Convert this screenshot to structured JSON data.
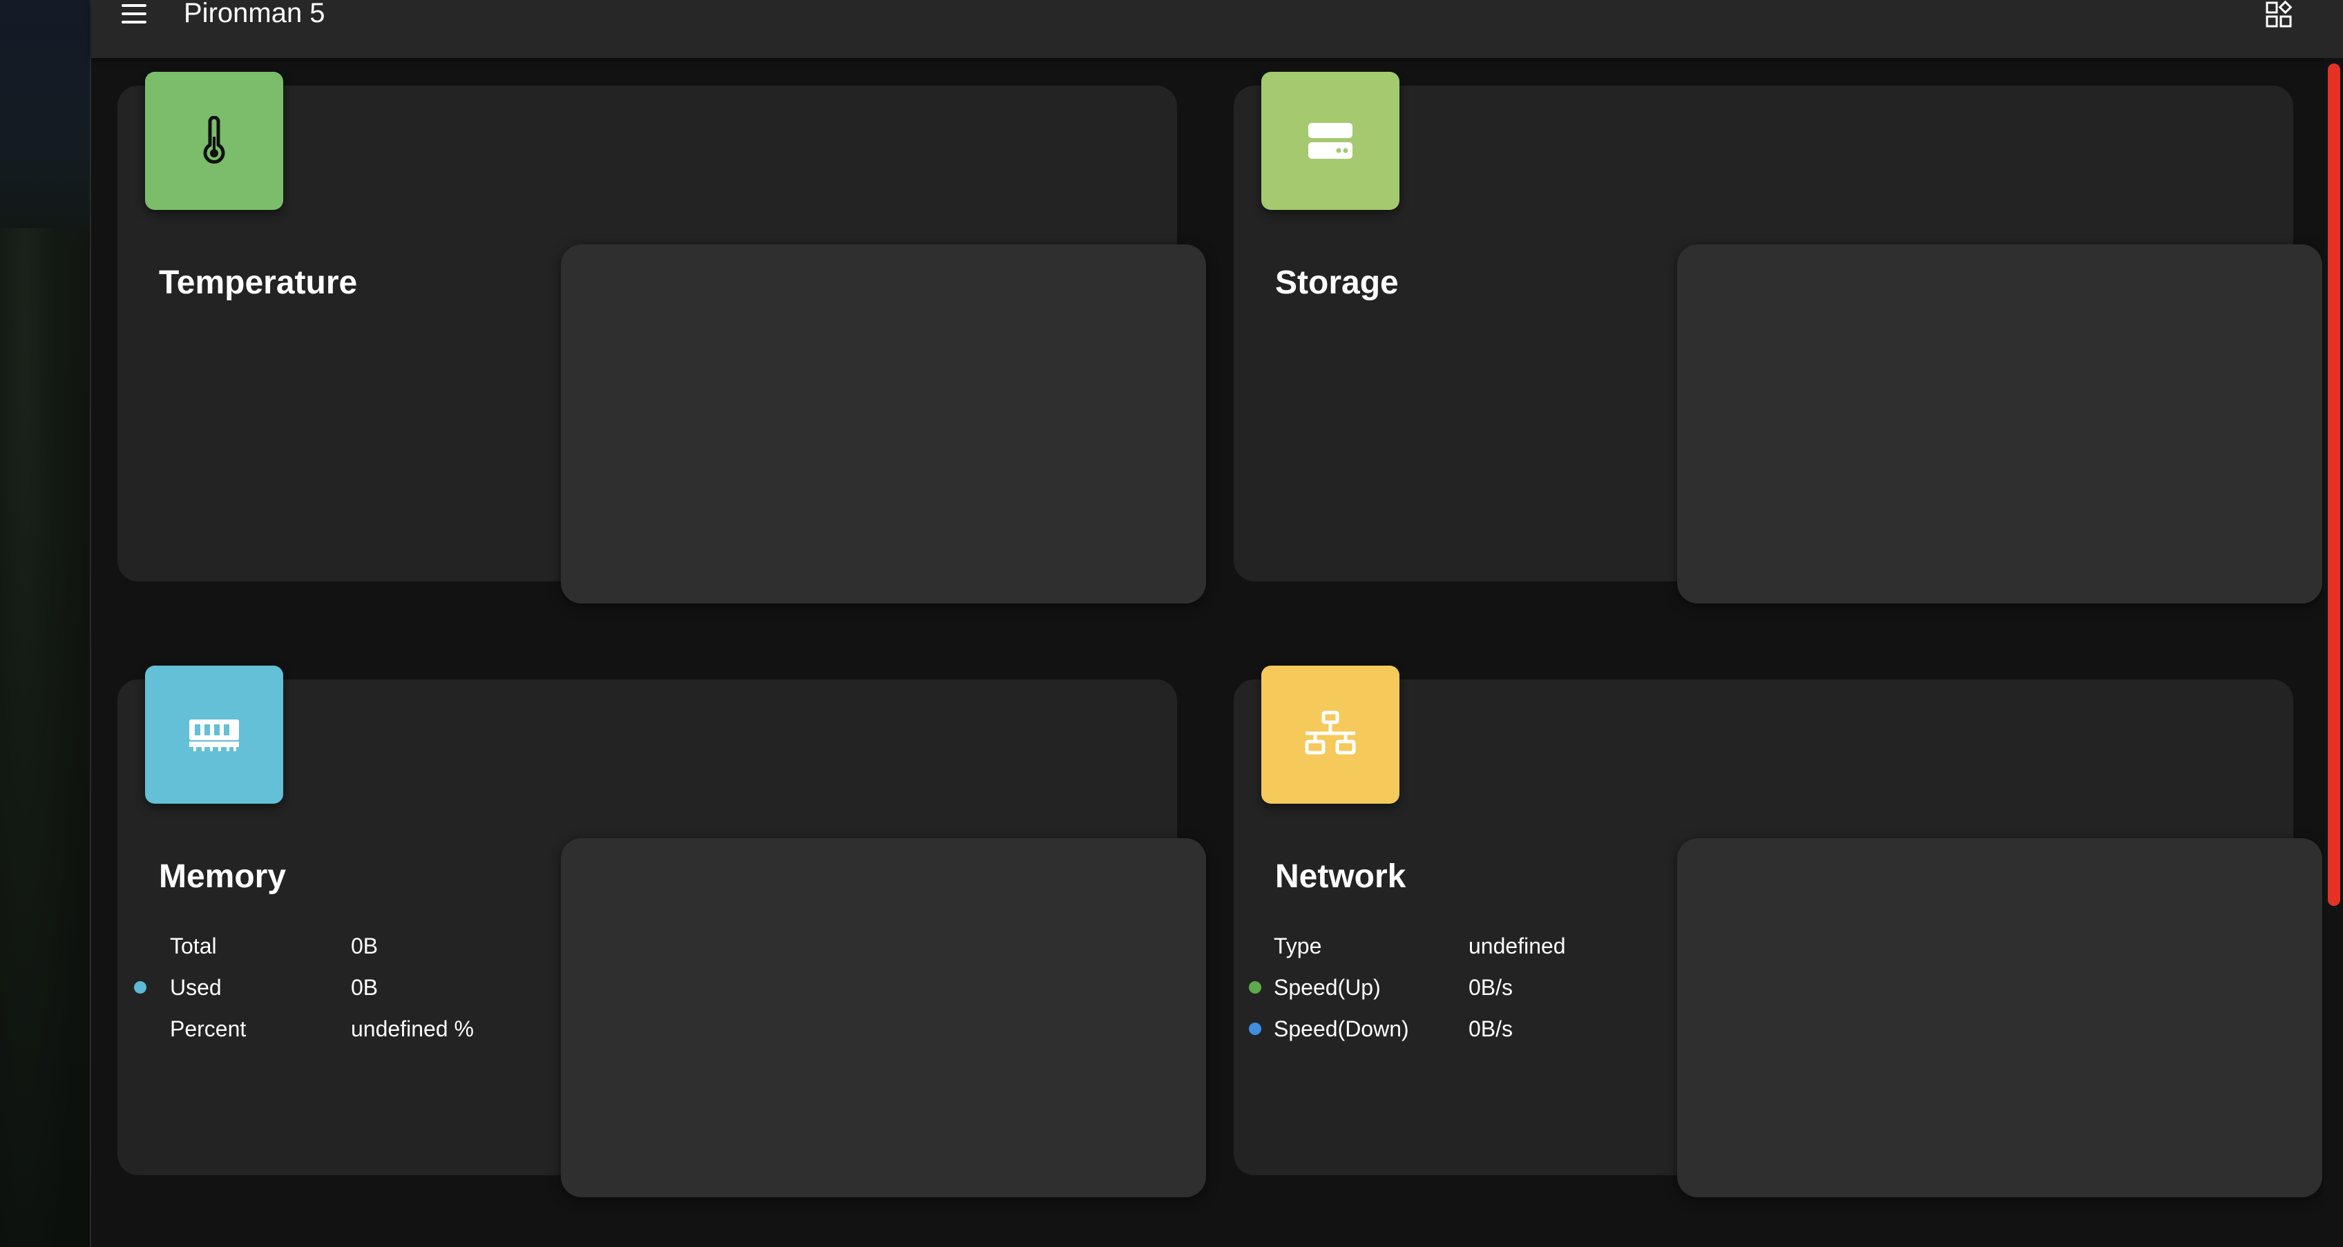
{
  "app": {
    "title": "Pironman 5",
    "menu_icon": "hamburger-menu-icon",
    "grid_icon": "widget-grid-icon",
    "accent": "#e53224"
  },
  "cards": {
    "temperature": {
      "title": "Temperature",
      "icon": "thermometer-icon",
      "color": "#7cbd6b"
    },
    "storage": {
      "title": "Storage",
      "icon": "hard-drive-icon",
      "color": "#a5c96e"
    },
    "memory": {
      "title": "Memory",
      "icon": "memory-chip-icon",
      "color": "#63c0d6",
      "stats": [
        {
          "label": "Total",
          "value": "0B",
          "dot": ""
        },
        {
          "label": "Used",
          "value": "0B",
          "dot": "#5bb9d6"
        },
        {
          "label": "Percent",
          "value": "undefined %",
          "dot": ""
        }
      ]
    },
    "network": {
      "title": "Network",
      "icon": "network-icon",
      "color": "#f5c95a",
      "stats": [
        {
          "label": "Type",
          "value": "undefined",
          "dot": ""
        },
        {
          "label": "Speed(Up)",
          "value": "0B/s",
          "dot": "#5da94c"
        },
        {
          "label": "Speed(Down)",
          "value": "0B/s",
          "dot": "#3f8ee0"
        }
      ]
    }
  }
}
